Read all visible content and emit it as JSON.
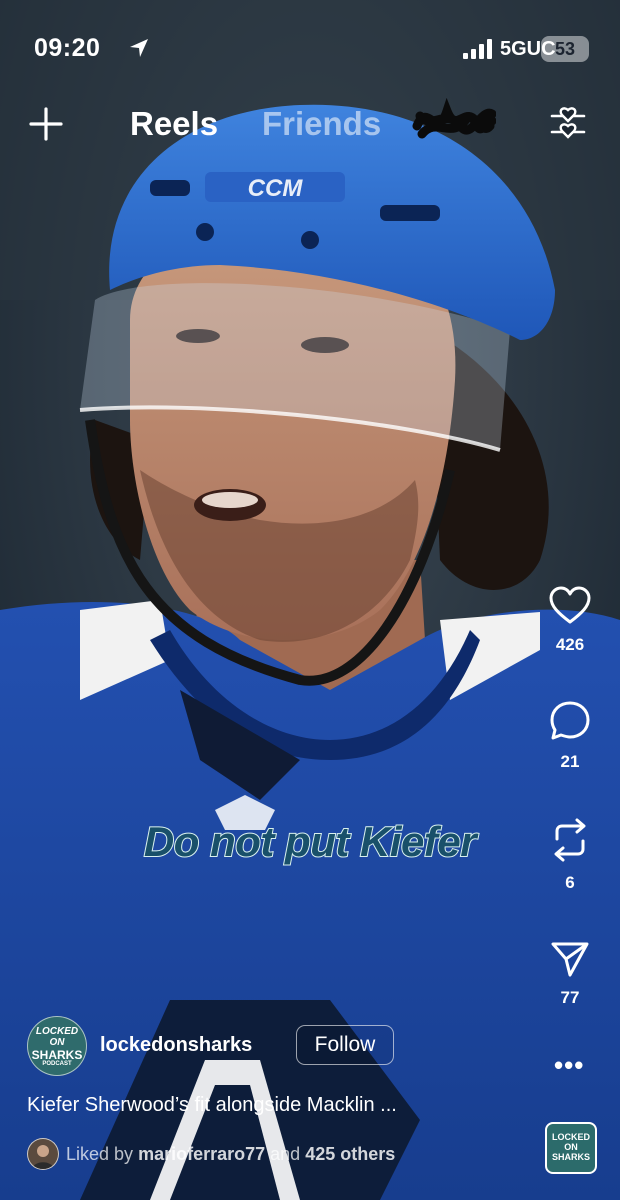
{
  "status_bar": {
    "time": "09:20",
    "network": "5GUC",
    "battery": "53"
  },
  "header": {
    "tabs": [
      {
        "label": "Reels",
        "active": true
      },
      {
        "label": "Friends",
        "active": false
      }
    ],
    "icons": [
      "plus-icon",
      "filter-icon"
    ]
  },
  "video": {
    "caption": "Do not put Kiefer"
  },
  "actions": {
    "likes": "426",
    "comments": "21",
    "reposts": "6",
    "shares": "77",
    "more": "•••"
  },
  "post": {
    "username": "lockedonsharks",
    "follow_label": "Follow",
    "description": "Kiefer Sherwood’s fit alongside Macklin ...",
    "liked_prefix": "Liked by",
    "liked_user": "marioferraro77",
    "liked_and": "and",
    "liked_others": "425 others"
  },
  "avatar_logo": {
    "line1": "LOCKED",
    "line2": "ON",
    "line3": "SHARKS",
    "line4": "PODCAST"
  },
  "colors": {
    "jersey_blue": "#1f4aa5",
    "helmet_blue": "#2d6ed1",
    "caption_fill": "#19506a",
    "caption_outline": "#d9f1ee"
  }
}
